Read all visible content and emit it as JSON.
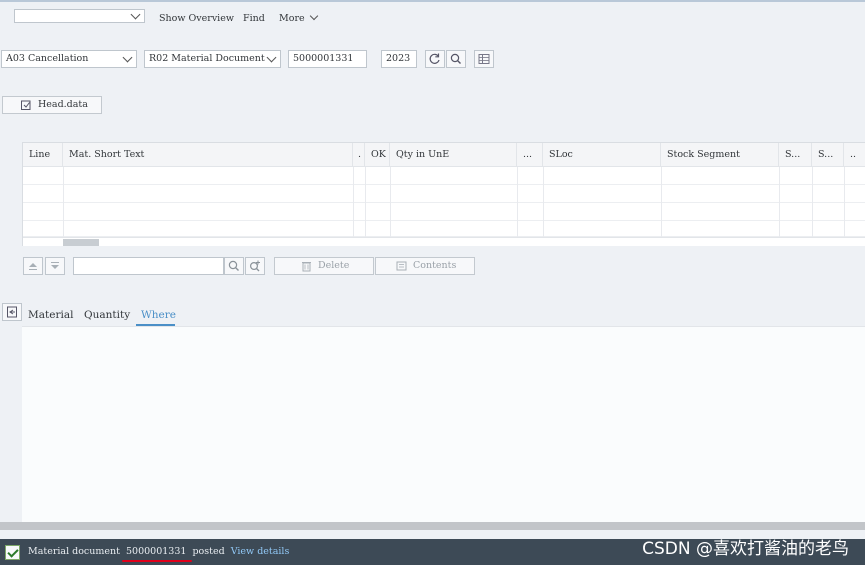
{
  "toolbar": {
    "variant_select_value": "",
    "show_overview": "Show Overview",
    "find": "Find",
    "more": "More"
  },
  "header_fields": {
    "action": "A03 Cancellation",
    "reference": "R02 Material Document",
    "document_number": "5000001331",
    "year": "2023"
  },
  "head_data_button": "Head.data",
  "item_table": {
    "columns": [
      "Line",
      "Mat. Short Text",
      ".",
      "OK",
      "Qty in UnE",
      "...",
      "SLoc",
      "Stock Segment",
      "S...",
      "S...",
      ".."
    ],
    "rows": []
  },
  "table_toolbar": {
    "search_value": "",
    "delete": "Delete",
    "contents": "Contents"
  },
  "detail_tabs": [
    {
      "label": "Material",
      "active": false
    },
    {
      "label": "Quantity",
      "active": false
    },
    {
      "label": "Where",
      "active": true
    }
  ],
  "status_bar": {
    "message_prefix": "Material document",
    "document_number": "5000001331",
    "message_suffix": "posted",
    "link": "View details",
    "watermark": "CSDN @喜欢打酱油的老鸟"
  },
  "colors": {
    "accent": "#0a6ed1",
    "status_bg": "#3d4a56",
    "link": "#91c8f6",
    "underline": "#e0001a"
  }
}
